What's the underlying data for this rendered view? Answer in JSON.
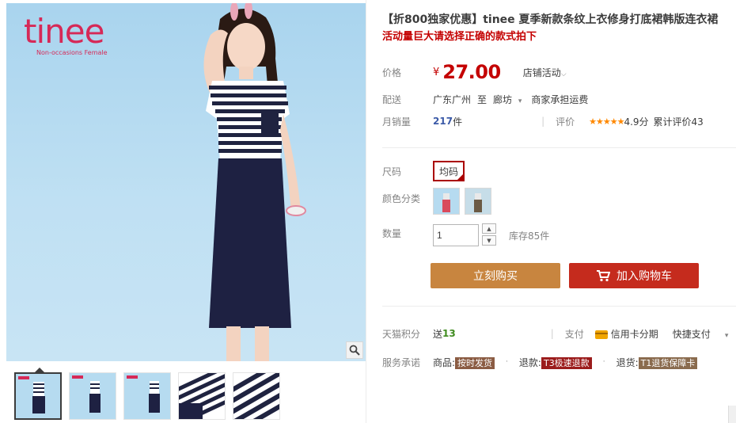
{
  "brand": {
    "name": "tinee",
    "tagline": "Non-occasions Female"
  },
  "product": {
    "title": "【折800独家优惠】tinee 夏季新款条纹上衣修身打底裙韩版连衣裙",
    "subtitle": "活动量巨大请选择正确的款式拍下"
  },
  "price": {
    "label": "价格",
    "currency": "¥",
    "value": "27.00",
    "promo_label": "店铺活动"
  },
  "shipping": {
    "label": "配送",
    "from": "广东广州",
    "to_word": "至",
    "to": "廊坊",
    "fee": "商家承担运费"
  },
  "sales": {
    "label": "月销量",
    "count": "217",
    "unit": "件",
    "rating_label": "评价",
    "stars": "★★★★★",
    "score": "4.9分",
    "reviews": "累计评价43"
  },
  "sku": {
    "size_label": "尺码",
    "size_value": "均码",
    "color_label": "颜色分类",
    "qty_label": "数量",
    "qty_value": "1",
    "stock": "库存85件"
  },
  "actions": {
    "buy_now": "立刻购买",
    "add_to_cart": "加入购物车"
  },
  "points": {
    "label": "天猫积分",
    "text": "送",
    "value": "13"
  },
  "payment": {
    "label": "支付",
    "method": "信用卡分期",
    "quick": "快捷支付"
  },
  "service": {
    "label": "服务承诺",
    "items": [
      {
        "prefix": "商品:",
        "badge": "按时发货"
      },
      {
        "prefix": "退款:",
        "badge": "T3极速退款"
      },
      {
        "prefix": "退货:",
        "badge": "T1退货保障卡"
      }
    ]
  },
  "colors": {
    "price_red": "#c40000",
    "buy_button": "#c8853f",
    "cart_button": "#c52b1d",
    "brand_pink": "#d62957"
  },
  "icons": [
    "zoom-icon",
    "cart-icon",
    "card-icon",
    "chevron-down-icon",
    "star-icon"
  ]
}
